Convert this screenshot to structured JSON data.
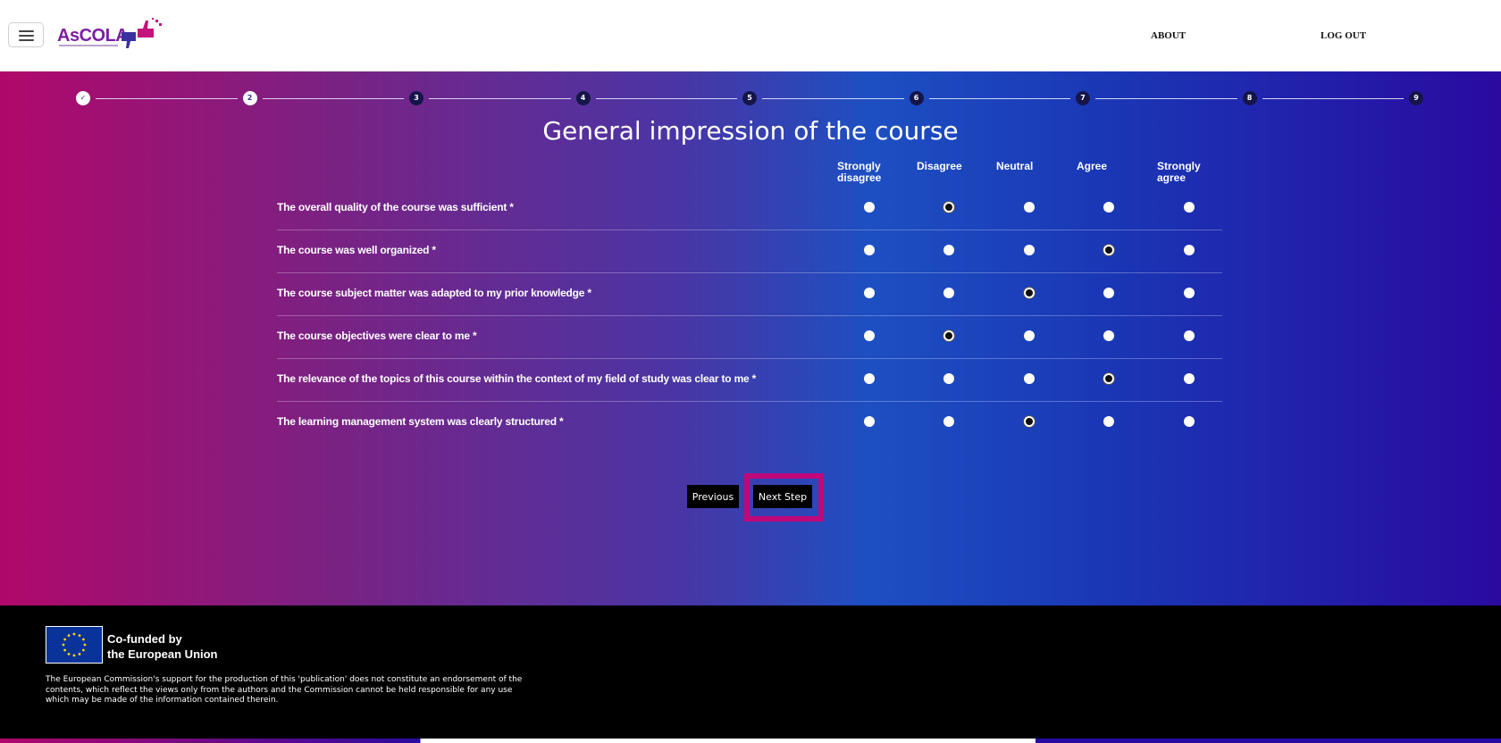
{
  "header": {
    "logo_text": "AsCOLA",
    "nav": {
      "about": "ABOUT",
      "logout": "LOG OUT"
    }
  },
  "stepper": {
    "steps": [
      "✓",
      "2",
      "3",
      "4",
      "5",
      "6",
      "7",
      "8",
      "9"
    ],
    "current_step": 2
  },
  "page_title": "General impression of the course",
  "scale": {
    "columns": [
      "Strongly disagree",
      "Disagree",
      "Neutral",
      "Agree",
      "Strongly agree"
    ]
  },
  "questions": [
    {
      "label": "The overall quality of the course was sufficient *",
      "selected": "Disagree"
    },
    {
      "label": "The course was well organized *",
      "selected": "Agree"
    },
    {
      "label": "The course subject matter was adapted to my prior knowledge *",
      "selected": "Neutral"
    },
    {
      "label": "The course objectives were clear to me *",
      "selected": "Disagree"
    },
    {
      "label": "The relevance of the topics of this course within the context of my field of study was clear to me *",
      "selected": "Agree"
    },
    {
      "label": "The learning management system was clearly structured *",
      "selected": "Neutral"
    }
  ],
  "buttons": {
    "previous": "Previous",
    "next": "Next Step"
  },
  "footer": {
    "cofund_line1": "Co-funded by",
    "cofund_line2": "the European Union",
    "disclaimer": "The European Commission's support for the production of this 'publication' does not constitute an endorsement of the contents, which reflect the views only from the authors and the Commission cannot be held responsible for any use which may be made of the information contained therein."
  },
  "colors": {
    "gradient_left": "#b0086a",
    "gradient_mid": "#1d4fc2",
    "gradient_right": "#2a0aa0",
    "highlight": "#c0077a"
  }
}
